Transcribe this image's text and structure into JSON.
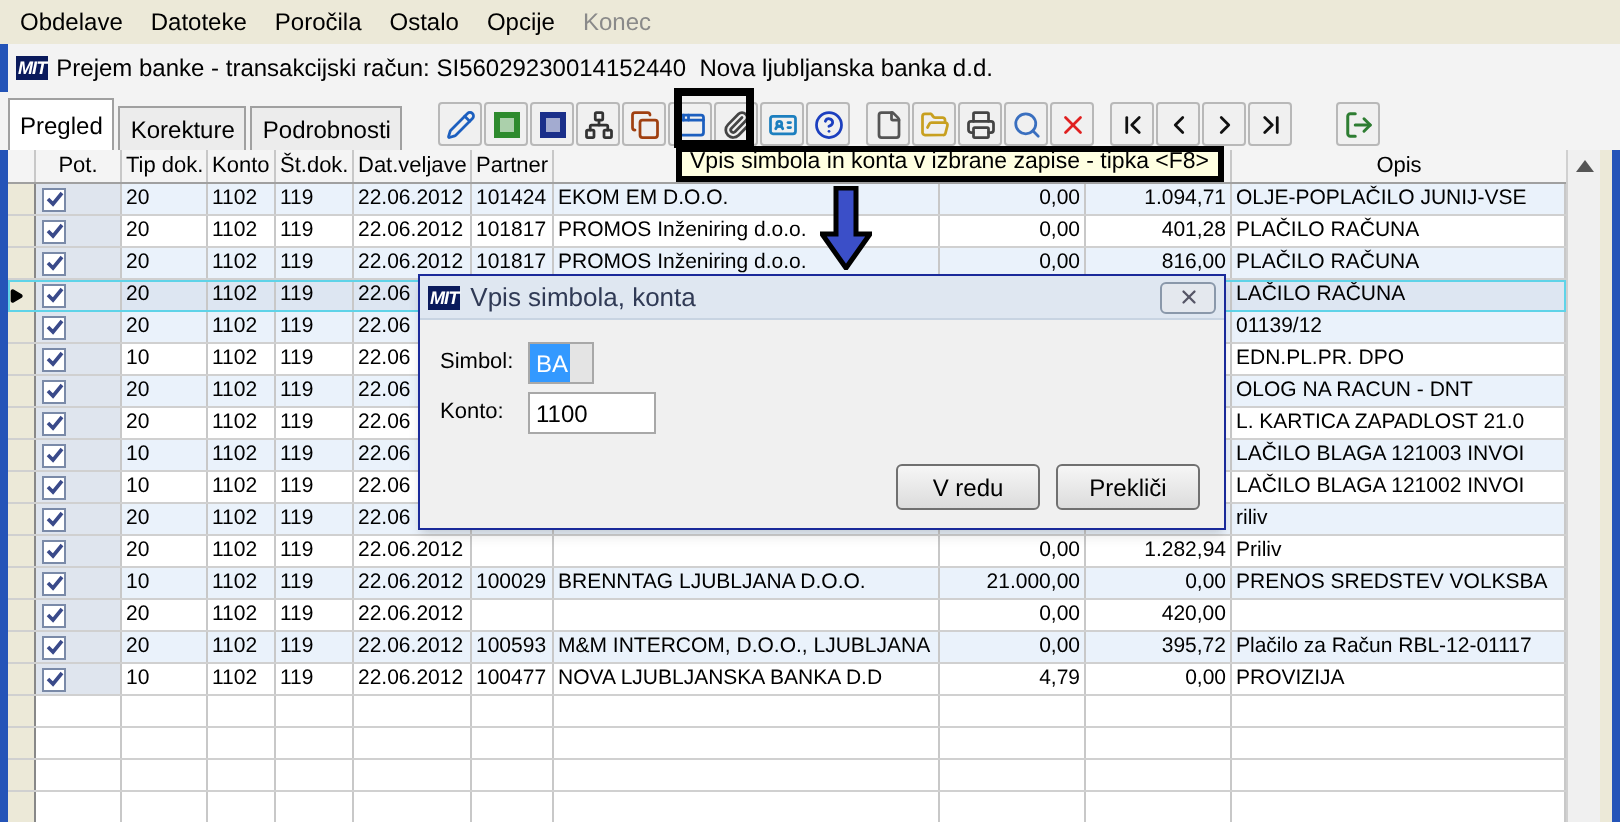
{
  "menu": [
    {
      "label": "Obdelave",
      "disabled": false
    },
    {
      "label": "Datoteke",
      "disabled": false
    },
    {
      "label": "Poročila",
      "disabled": false
    },
    {
      "label": "Ostalo",
      "disabled": false
    },
    {
      "label": "Opcije",
      "disabled": false
    },
    {
      "label": "Konec",
      "disabled": true
    }
  ],
  "window": {
    "logo": "MIT",
    "title": "Prejem banke - transakcijski račun: SI56029230014152440  Nova ljubljanska banka d.d."
  },
  "tabs": [
    {
      "label": "Pregled",
      "selected": true
    },
    {
      "label": "Korekture",
      "selected": false
    },
    {
      "label": "Podrobnosti",
      "selected": false
    }
  ],
  "tooltip": "Vpis simbola in konta v izbrane zapise - tipka <F8>",
  "table": {
    "columns": [
      "Pot.",
      "Tip dok.",
      "Konto",
      "Št.dok.",
      "Dat.veljave",
      "Partner",
      "Opis"
    ],
    "rows": [
      {
        "selected": false,
        "checked": true,
        "tip": "20",
        "konto": "1102",
        "st_dok": "119",
        "date": "22.06.2012",
        "partner_code": "101424",
        "partner": "EKOM EM D.O.O.",
        "debit": "0,00",
        "credit": "1.094,71",
        "opis": "OLJE-POPLAČILO JUNIJ-VSE"
      },
      {
        "selected": false,
        "checked": true,
        "tip": "20",
        "konto": "1102",
        "st_dok": "119",
        "date": "22.06.2012",
        "partner_code": "101817",
        "partner": "PROMOS Inženiring d.o.o.",
        "debit": "0,00",
        "credit": "401,28",
        "opis": "PLAČILO RAČUNA"
      },
      {
        "selected": false,
        "checked": true,
        "tip": "20",
        "konto": "1102",
        "st_dok": "119",
        "date": "22.06.2012",
        "partner_code": "101817",
        "partner": "PROMOS Inženiring d.o.o.",
        "debit": "0,00",
        "credit": "816,00",
        "opis": "PLAČILO RAČUNA"
      },
      {
        "selected": true,
        "checked": true,
        "tip": "20",
        "konto": "1102",
        "st_dok": "119",
        "date": "22.06",
        "opis": "LAČILO RAČUNA"
      },
      {
        "selected": false,
        "checked": true,
        "tip": "20",
        "konto": "1102",
        "st_dok": "119",
        "date": "22.06",
        "opis": "01139/12"
      },
      {
        "selected": false,
        "checked": true,
        "tip": "10",
        "konto": "1102",
        "st_dok": "119",
        "date": "22.06",
        "opis": "EDN.PL.PR. DPO"
      },
      {
        "selected": false,
        "checked": true,
        "tip": "20",
        "konto": "1102",
        "st_dok": "119",
        "date": "22.06",
        "opis": "OLOG NA RACUN - DNT"
      },
      {
        "selected": false,
        "checked": true,
        "tip": "20",
        "konto": "1102",
        "st_dok": "119",
        "date": "22.06",
        "opis": "L. KARTICA ZAPADLOST 21.0"
      },
      {
        "selected": false,
        "checked": true,
        "tip": "10",
        "konto": "1102",
        "st_dok": "119",
        "date": "22.06",
        "opis": "LAČILO BLAGA 121003 INVOI"
      },
      {
        "selected": false,
        "checked": true,
        "tip": "10",
        "konto": "1102",
        "st_dok": "119",
        "date": "22.06",
        "opis": "LAČILO BLAGA 121002 INVOI"
      },
      {
        "selected": false,
        "checked": true,
        "tip": "20",
        "konto": "1102",
        "st_dok": "119",
        "date": "22.06",
        "opis": "riliv"
      },
      {
        "selected": false,
        "checked": true,
        "tip": "20",
        "konto": "1102",
        "st_dok": "119",
        "date": "22.06.2012",
        "debit": "0,00",
        "credit": "1.282,94",
        "opis": "Priliv"
      },
      {
        "selected": false,
        "checked": true,
        "tip": "10",
        "konto": "1102",
        "st_dok": "119",
        "date": "22.06.2012",
        "partner_code": "100029",
        "partner": "BRENNTAG LJUBLJANA D.O.O.",
        "debit": "21.000,00",
        "credit": "0,00",
        "opis": "PRENOS SREDSTEV VOLKSBA"
      },
      {
        "selected": false,
        "checked": true,
        "tip": "20",
        "konto": "1102",
        "st_dok": "119",
        "date": "22.06.2012",
        "debit": "0,00",
        "credit": "420,00"
      },
      {
        "selected": false,
        "checked": true,
        "tip": "20",
        "konto": "1102",
        "st_dok": "119",
        "date": "22.06.2012",
        "partner_code": "100593",
        "partner": "M&M INTERCOM,  D.O.O.,  LJUBLJANA",
        "debit": "0,00",
        "credit": "395,72",
        "opis": "Plačilo za Račun RBL-12-01117"
      },
      {
        "selected": false,
        "checked": true,
        "tip": "10",
        "konto": "1102",
        "st_dok": "119",
        "date": "22.06.2012",
        "partner_code": "100477",
        "partner": "NOVA LJUBLJANSKA BANKA D.D",
        "debit": "4,79",
        "credit": "0,00",
        "opis": "PROVIZIJA"
      }
    ]
  },
  "dialog": {
    "logo": "MIT",
    "title": "Vpis simbola, konta",
    "fields": [
      {
        "label": "Simbol:",
        "value": "BA",
        "disabled": true
      },
      {
        "label": "Konto:",
        "value": "1100",
        "disabled": false
      }
    ],
    "buttons": [
      "V redu",
      "Prekliči"
    ]
  }
}
